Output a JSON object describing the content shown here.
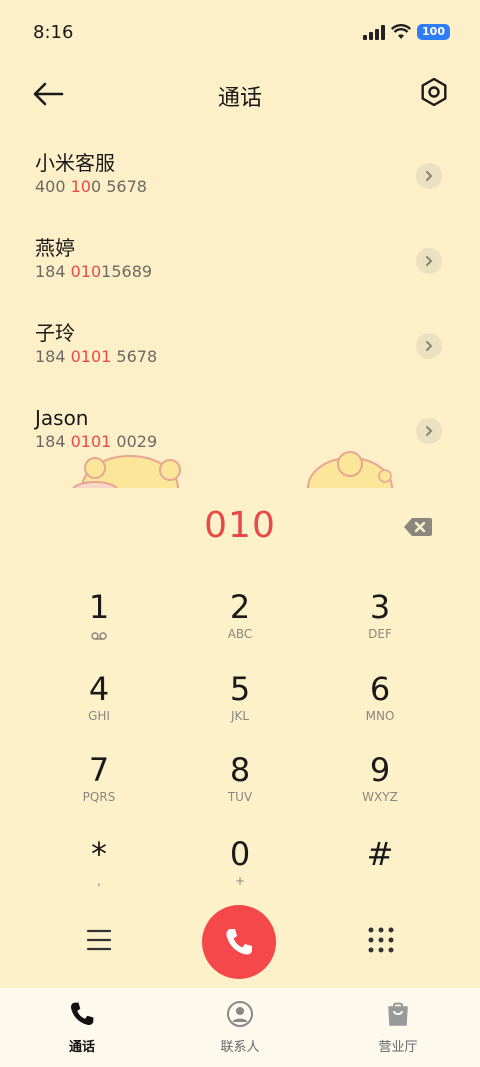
{
  "status_bar": {
    "time": "8:16",
    "battery": "100"
  },
  "header": {
    "title": "通话",
    "back_icon": "arrow-left-icon",
    "settings_icon": "hexagon-settings-icon"
  },
  "contacts": [
    {
      "name": "小米客服",
      "num_pre": "400 ",
      "num_hl": "10",
      "num_post": "0 5678"
    },
    {
      "name": "燕婷",
      "num_pre": "184 ",
      "num_hl": "010",
      "num_post": "15689"
    },
    {
      "name": "子玲",
      "num_pre": "184 ",
      "num_hl": "0101",
      "num_post": " 5678"
    },
    {
      "name": "Jason",
      "num_pre": "184 ",
      "num_hl": "0101",
      "num_post": " 0029"
    }
  ],
  "dialpad": {
    "typed_number": "010",
    "keys": [
      {
        "digit": "1",
        "letters": ""
      },
      {
        "digit": "2",
        "letters": "ABC"
      },
      {
        "digit": "3",
        "letters": "DEF"
      },
      {
        "digit": "4",
        "letters": "GHI"
      },
      {
        "digit": "5",
        "letters": "JKL"
      },
      {
        "digit": "6",
        "letters": "MNO"
      },
      {
        "digit": "7",
        "letters": "PQRS"
      },
      {
        "digit": "8",
        "letters": "TUV"
      },
      {
        "digit": "9",
        "letters": "WXYZ"
      },
      {
        "digit": "*",
        "letters": ","
      },
      {
        "digit": "0",
        "letters": "+"
      },
      {
        "digit": "#",
        "letters": ""
      }
    ]
  },
  "colors": {
    "accent": "#e84a48",
    "background": "#fdf0c8",
    "call_button": "#f4484a"
  },
  "bottom_nav": [
    {
      "label": "通话",
      "icon": "phone-icon",
      "active": true
    },
    {
      "label": "联系人",
      "icon": "contact-icon",
      "active": false
    },
    {
      "label": "营业厅",
      "icon": "shopping-bag-icon",
      "active": false
    }
  ]
}
